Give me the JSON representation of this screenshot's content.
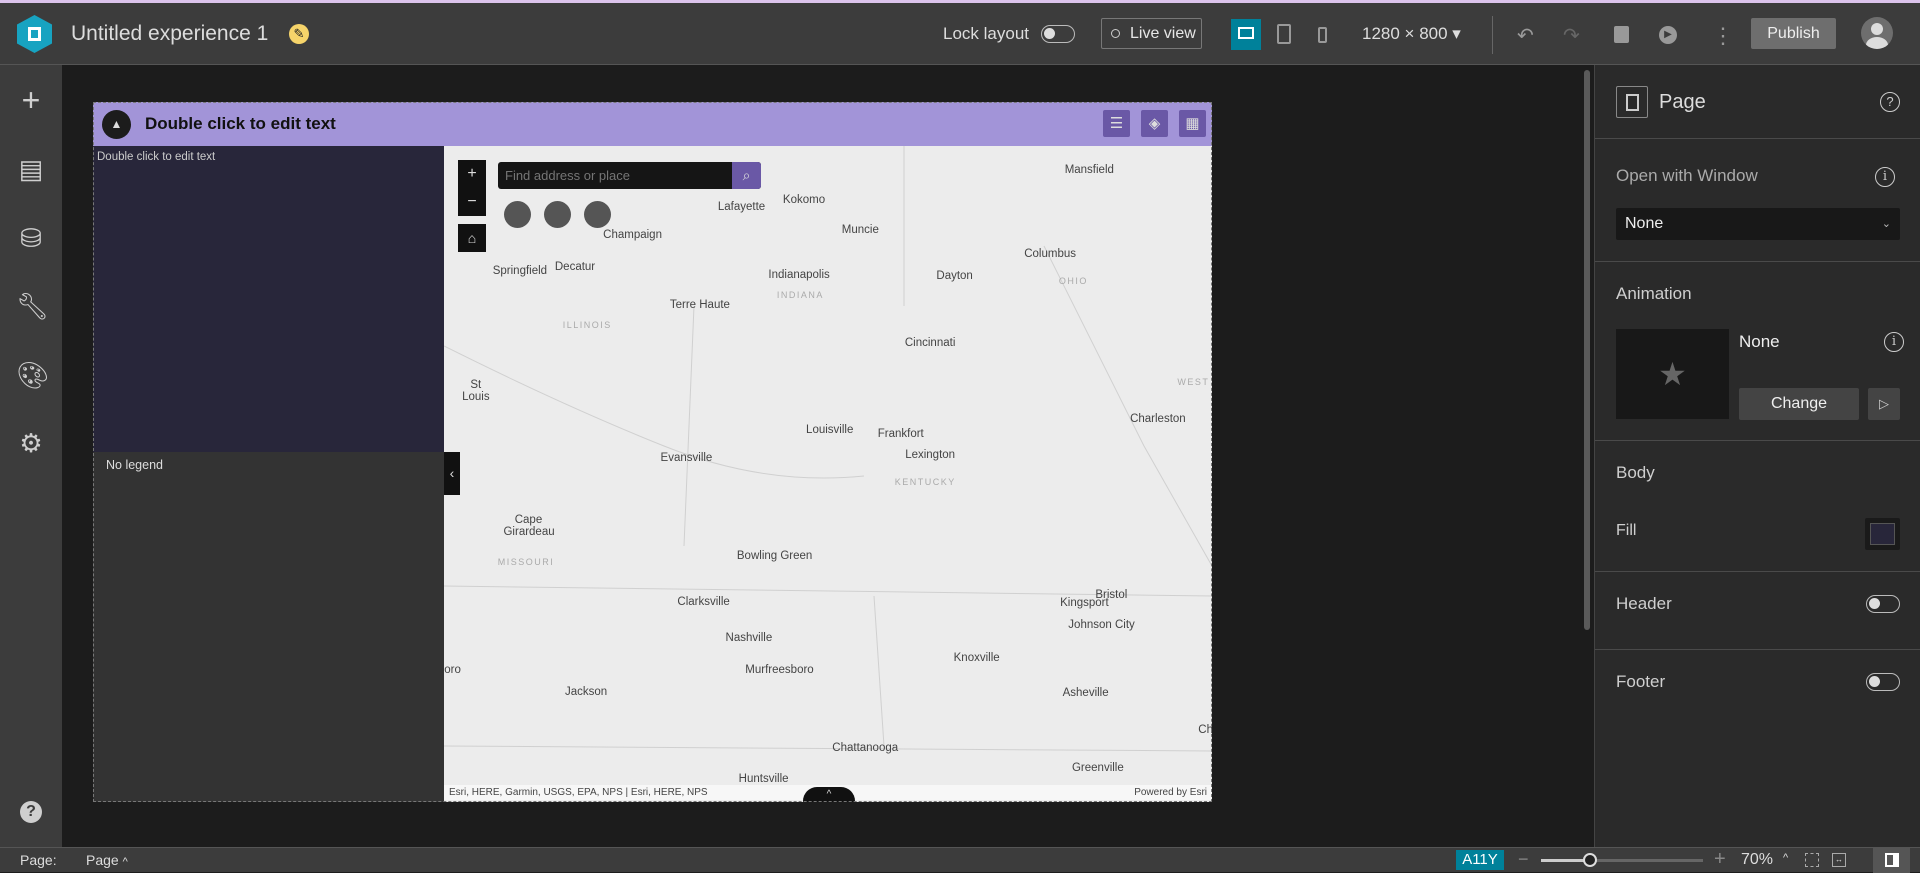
{
  "topbar": {
    "title": "Untitled experience 1",
    "lock_layout": "Lock layout",
    "live_view": "Live view",
    "resolution": "1280 × 800",
    "publish": "Publish"
  },
  "canvas": {
    "header_text": "Double click to edit text",
    "text_widget": "Double click to edit text",
    "legend_text": "No legend",
    "search_placeholder": "Find address or place",
    "attribution": "Esri, HERE, Garmin, USGS, EPA, NPS | Esri, HERE, NPS",
    "powered_by": "Powered by Esri",
    "zoom_in": "+",
    "zoom_out": "−",
    "cities": [
      "Mansfield",
      "Lafayette",
      "Kokomo",
      "Muncie",
      "Champaign",
      "Springfield",
      "Decatur",
      "Indianapolis",
      "Dayton",
      "Columbus",
      "Terre Haute",
      "Cincinnati",
      "St Louis",
      "Charleston",
      "Louisville",
      "Frankfort",
      "Lexington",
      "Evansville",
      "Cape Girardeau",
      "Bowling Green",
      "Clarksville",
      "Kingsport",
      "Bristol",
      "Johnson City",
      "Nashville",
      "Murfreesboro",
      "Knoxville",
      "oro",
      "Jackson",
      "Asheville",
      "Chattanooga",
      "Ch",
      "Greenville",
      "Huntsville"
    ],
    "states": [
      "INDIANA",
      "OHIO",
      "ILLINOIS",
      "WEST",
      "KENTUCKY",
      "MISSOURI"
    ]
  },
  "panel": {
    "title": "Page",
    "open_with_window": "Open with Window",
    "window_value": "None",
    "animation": "Animation",
    "animation_value": "None",
    "change": "Change",
    "body": "Body",
    "fill": "Fill",
    "fill_color": "#28263a",
    "header": "Header",
    "footer": "Footer"
  },
  "bottombar": {
    "page_label": "Page:",
    "page_value": "Page",
    "a11y": "A11Y",
    "zoom": "70%",
    "zoom_fraction": 0.3
  },
  "colors": {
    "accent": "#00819a",
    "header_purple": "#a294d8",
    "button_purple": "#6a58a6"
  }
}
